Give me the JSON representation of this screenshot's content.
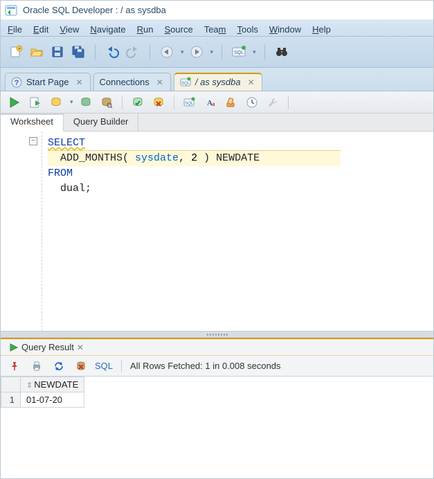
{
  "titlebar": {
    "text": "Oracle SQL Developer : / as sysdba"
  },
  "menu": {
    "file": "File",
    "edit": "Edit",
    "view": "View",
    "navigate": "Navigate",
    "run": "Run",
    "source": "Source",
    "team": "Team",
    "tools": "Tools",
    "window": "Window",
    "help": "Help"
  },
  "doctabs": {
    "start": "Start Page",
    "connections": "Connections",
    "active": "/ as sysdba"
  },
  "wstabs": {
    "worksheet": "Worksheet",
    "querybuilder": "Query Builder"
  },
  "code": {
    "line1": "SELECT",
    "line2_prefix": "  ",
    "line2_func": "ADD_MONTHS",
    "line2_lparen": "( ",
    "line2_arg1": "sysdate",
    "line2_comma": ", ",
    "line2_arg2": "2",
    "line2_rparen": " )",
    "line2_alias": " NEWDATE",
    "line3": "FROM",
    "line4": "  dual;"
  },
  "result": {
    "tab_label": "Query Result",
    "sql_label": "SQL",
    "status": "All Rows Fetched: 1 in 0.008 seconds",
    "columns": [
      "NEWDATE"
    ],
    "rows": [
      {
        "n": "1",
        "cells": [
          "01-07-20"
        ]
      }
    ]
  }
}
